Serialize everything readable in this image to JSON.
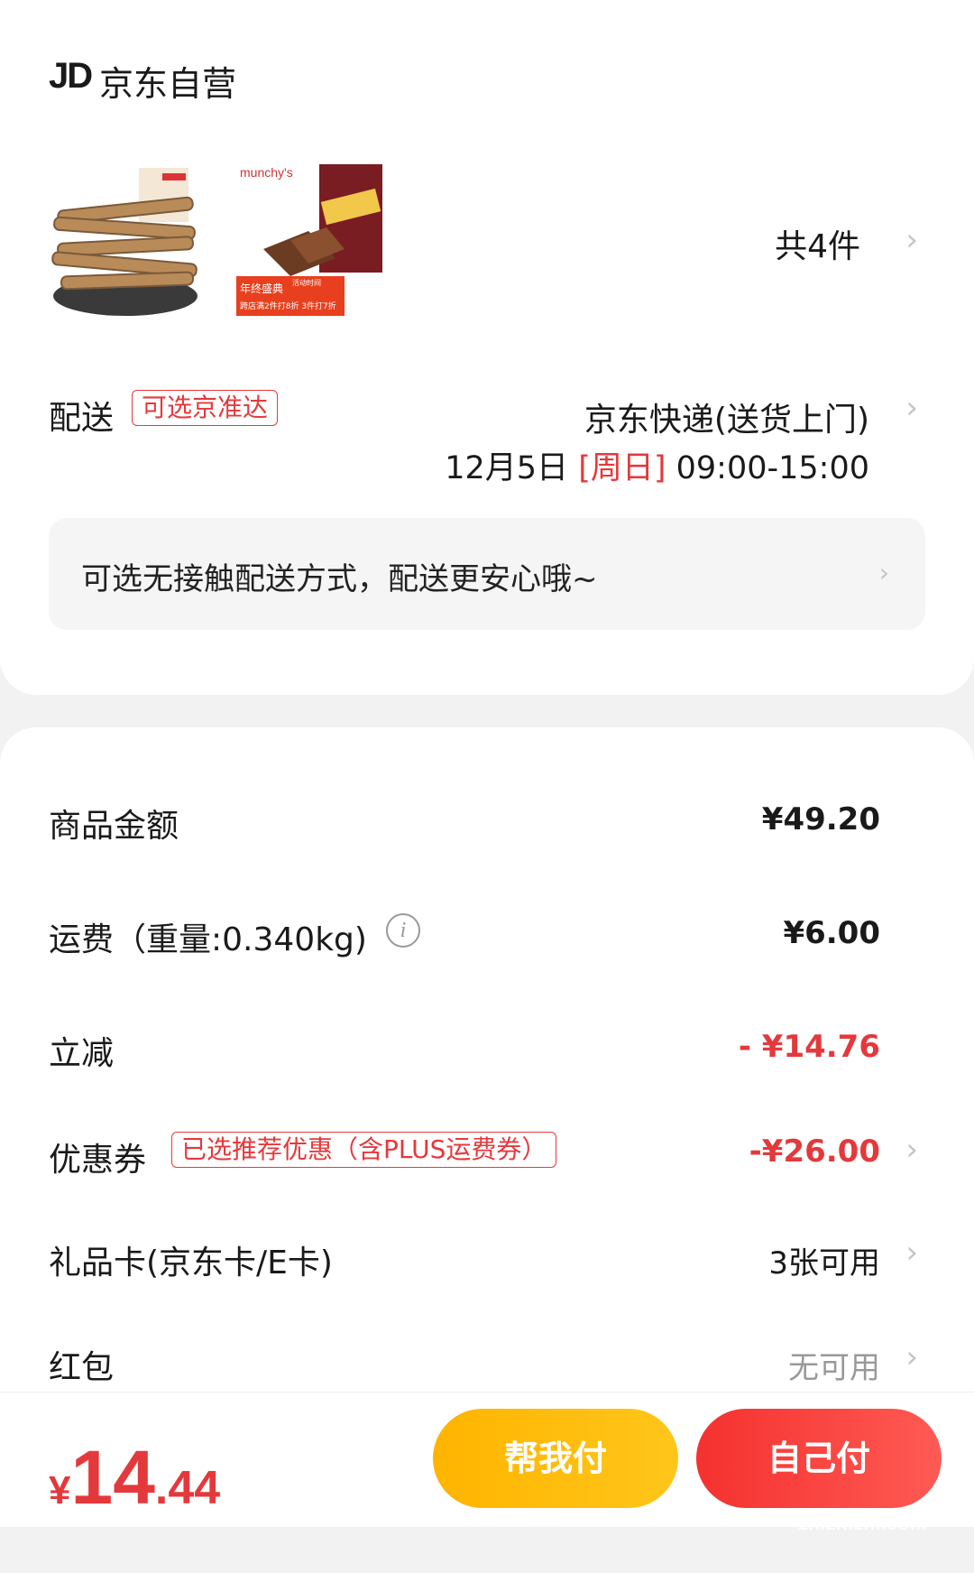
{
  "store": {
    "logo": "JD",
    "name": "京东自营"
  },
  "products": {
    "items": [
      {
        "name": "snack-strips-product"
      },
      {
        "name": "munchys-muzic-wafer-product",
        "brand": "munchy's",
        "promo_line1": "年终盛典",
        "promo_line2": "活动时间",
        "promo_line3": "跨店满2件打8折 3件打7折"
      }
    ],
    "count_label": "共4件"
  },
  "delivery": {
    "label": "配送",
    "tag": "可选京准达",
    "method": "京东快递(送货上门)",
    "date": "12月5日",
    "weekday": "[周日]",
    "time": "09:00-15:00",
    "notice": "可选无接触配送方式，配送更安心哦~"
  },
  "summary": {
    "goods": {
      "label": "商品金额",
      "value": "¥49.20"
    },
    "freight": {
      "label": "运费（重量:0.340kg)",
      "value": "¥6.00"
    },
    "discount": {
      "label": "立减",
      "value": "- ¥14.76"
    },
    "coupon": {
      "label": "优惠券",
      "tag": "已选推荐优惠（含PLUS运费券）",
      "value": "-¥26.00"
    },
    "giftcard": {
      "label": "礼品卡(京东卡/E卡)",
      "value": "3张可用"
    },
    "redpacket": {
      "label": "红包",
      "value": "无可用"
    }
  },
  "bottom": {
    "currency": "¥",
    "price_int": "14",
    "price_dec": ".44",
    "help_pay": "帮我付",
    "self_pay": "自己付",
    "watermark": "zhizhizhi.com"
  },
  "colors": {
    "accent": "#e4393c",
    "help_button": "#ffbd0a",
    "self_button": "#f5312f"
  }
}
